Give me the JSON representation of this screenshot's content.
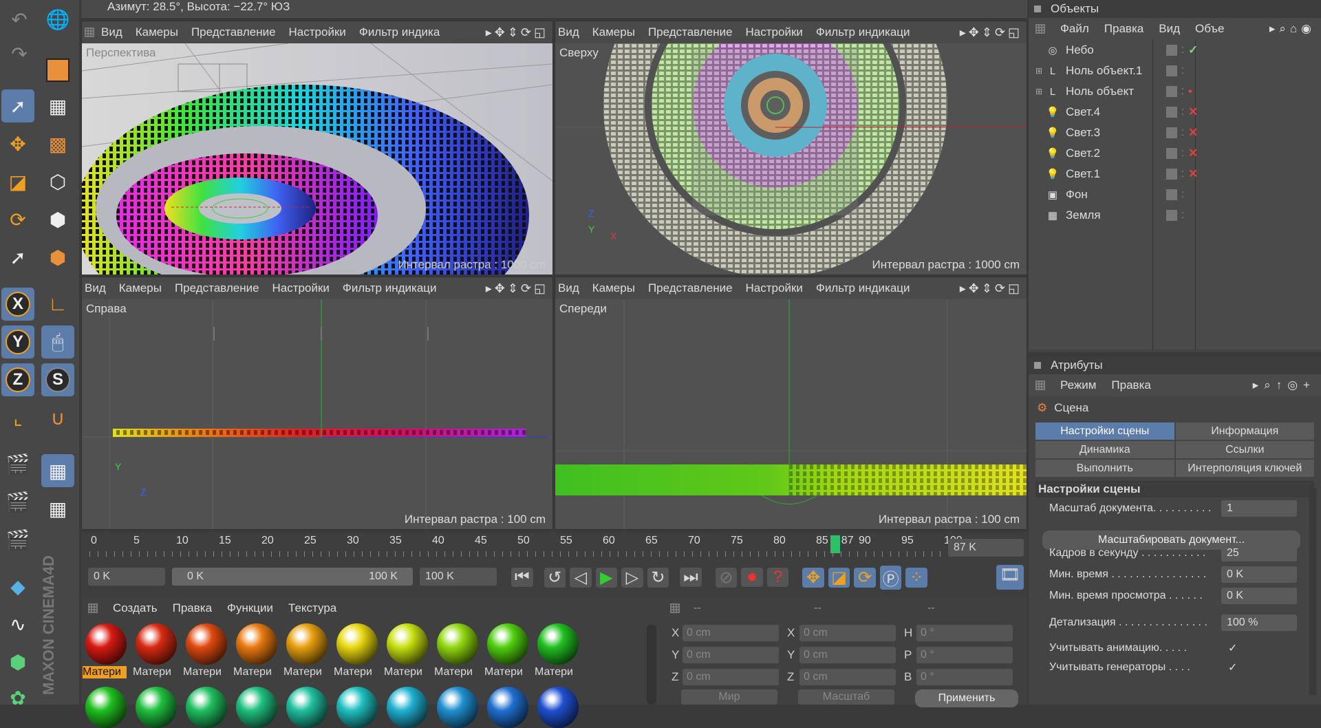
{
  "status": {
    "text": "Азимут: 28.5°, Высота: −22.7°  ЮЗ"
  },
  "viewport_menu": [
    "Вид",
    "Камеры",
    "Представление",
    "Настройки",
    "Фильтр индика"
  ],
  "viewport_menu2": [
    "Вид",
    "Камеры",
    "Представление",
    "Настройки",
    "Фильтр индикаци"
  ],
  "viewports": {
    "tl": {
      "label": "Перспектива",
      "grid": "Интервал растра : 1000 cm"
    },
    "tr": {
      "label": "Сверху",
      "grid": "Интервал растра : 1000 cm"
    },
    "bl": {
      "label": "Справа",
      "grid": "Интервал растра : 100 cm"
    },
    "br": {
      "label": "Спереди",
      "grid": "Интервал растра : 100 cm"
    }
  },
  "axes": {
    "x": "X",
    "y": "Y",
    "z": "Z"
  },
  "objects": {
    "title": "Объекты",
    "menu": [
      "Файл",
      "Правка",
      "Вид",
      "Объе"
    ],
    "items": [
      {
        "name": "Небо",
        "icon": "sky-icon",
        "flag": "✓",
        "flag_color": "#7ed37e"
      },
      {
        "name": "Ноль объект.1",
        "icon": "null-icon",
        "flag": "",
        "flag_color": ""
      },
      {
        "name": "Ноль объект",
        "icon": "null-icon",
        "flag": "•",
        "flag_color": "#e04040"
      },
      {
        "name": "Свет.4",
        "icon": "light-icon",
        "flag": "✕",
        "flag_color": "#e04040"
      },
      {
        "name": "Свет.3",
        "icon": "light-icon",
        "flag": "✕",
        "flag_color": "#e04040"
      },
      {
        "name": "Свет.2",
        "icon": "light-icon",
        "flag": "✕",
        "flag_color": "#e04040"
      },
      {
        "name": "Свет.1",
        "icon": "light-icon",
        "flag": "✕",
        "flag_color": "#e04040"
      },
      {
        "name": "Фон",
        "icon": "background-icon",
        "flag": "",
        "flag_color": ""
      },
      {
        "name": "Земля",
        "icon": "floor-icon",
        "flag": "",
        "flag_color": ""
      }
    ]
  },
  "attributes": {
    "title": "Атрибуты",
    "menu": [
      "Режим",
      "Правка"
    ],
    "object": "Сцена",
    "tabs": [
      "Настройки сцены",
      "Информация",
      "Динамика",
      "Ссылки",
      "Выполнить",
      "Интерполяция ключей"
    ],
    "section": "Настройки сцены",
    "fields": [
      {
        "label": "Масштаб документа. . . . . . . . . .",
        "value": "1"
      },
      {
        "label": "Кадров в секунду . . . . . . . . . . .",
        "value": "25"
      },
      {
        "label": "Мин. время . . . . . . . . . . . . . . . .",
        "value": "0 K"
      },
      {
        "label": "Мин. время просмотра . . . . . .",
        "value": "0 K"
      },
      {
        "label": "Детализация . . . . . . . . . . . . . . .",
        "value": "100 %"
      }
    ],
    "scale_button": "Масштабировать документ...",
    "checks": [
      {
        "label": "Учитывать анимацию. . . . .",
        "mark": "✓"
      },
      {
        "label": "Учитывать генераторы . . . .",
        "mark": "✓"
      }
    ]
  },
  "timeline": {
    "ticks": [
      "0",
      "5",
      "10",
      "15",
      "20",
      "25",
      "30",
      "35",
      "40",
      "45",
      "50",
      "55",
      "60",
      "65",
      "70",
      "75",
      "80",
      "85",
      "90",
      "95",
      "100"
    ],
    "current": "87",
    "current_field": "87 K",
    "start": "0 K",
    "range_start": "0 K",
    "range_end": "100 K",
    "end": "100 K",
    "progress": 0.87
  },
  "materials": {
    "menu": [
      "Создать",
      "Правка",
      "Функции",
      "Текстура"
    ],
    "label": "Матери",
    "first_label": "Матери",
    "colors_row1": [
      "#d81a12",
      "#d82a12",
      "#e04a10",
      "#e87a10",
      "#e8a010",
      "#e8d810",
      "#c8e010",
      "#90d810",
      "#50d010",
      "#20c020"
    ],
    "colors_row2": [
      "#20c020",
      "#20c040",
      "#20c060",
      "#20c080",
      "#20c0a0",
      "#20c0c0",
      "#20b0d0",
      "#2090d0",
      "#2070d0",
      "#2050d0"
    ]
  },
  "coords": {
    "header": [
      "--",
      "--",
      "--"
    ],
    "rows": [
      {
        "a": "X",
        "av": "0 cm",
        "b": "X",
        "bv": "0 cm",
        "c": "H",
        "cv": "0 °"
      },
      {
        "a": "Y",
        "av": "0 cm",
        "b": "Y",
        "bv": "0 cm",
        "c": "P",
        "cv": "0 °"
      },
      {
        "a": "Z",
        "av": "0 cm",
        "b": "Z",
        "bv": "0 cm",
        "c": "B",
        "cv": "0 °"
      }
    ],
    "world": "Мир",
    "scale": "Масштаб",
    "apply": "Применить"
  },
  "brand": "MAXON CINEMA4D"
}
